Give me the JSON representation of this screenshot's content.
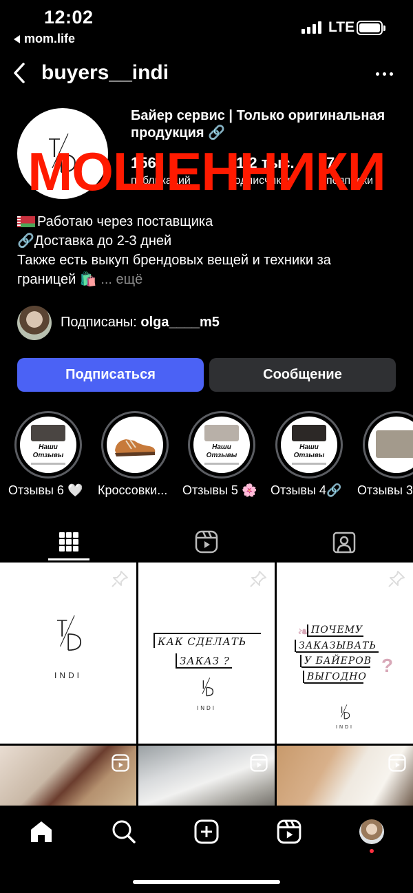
{
  "status": {
    "time": "12:02",
    "back_app": "mom.life",
    "network": "LTE"
  },
  "header": {
    "username": "buyers__indi"
  },
  "profile": {
    "avatar_logo": "I/D",
    "full_name": "Байер сервис | Только оригинальная продукция 🔗",
    "stats": [
      {
        "num": "156",
        "label": "публикаций"
      },
      {
        "num": "11,2 тыс.",
        "label": "подписчиков"
      },
      {
        "num": "7",
        "label": "подписки"
      }
    ],
    "overlay": "МОШЕННИКИ",
    "bio": {
      "line1": "Работаю через поставщика",
      "line2": "🔗Доставка до 2-3 дней",
      "line3": "Также есть выкуп брендовых вещей и техники за",
      "line4": "границей 🛍️",
      "more": "... ещё"
    },
    "followed_by": {
      "prefix": "Подписаны: ",
      "user": "olga____m5"
    }
  },
  "actions": {
    "follow": "Подписаться",
    "message": "Сообщение"
  },
  "highlights": [
    {
      "label": "Отзывы 6 🤍",
      "title": "Наши\nОтзывы"
    },
    {
      "label": "Кроссовки...",
      "title": ""
    },
    {
      "label": "Отзывы 5 🌸",
      "title": "Наши\nОтзывы"
    },
    {
      "label": "Отзывы 4🔗",
      "title": "Наши\nОтзывы"
    },
    {
      "label": "Отзывы 3",
      "title": ""
    }
  ],
  "posts": {
    "p1": {
      "logo": "I/D",
      "brand": "INDI"
    },
    "p2": {
      "line1": "КАК СДЕЛАТЬ",
      "line2": "ЗАКАЗ ?",
      "logo": "I/D",
      "brand": "INDI"
    },
    "p3": {
      "line1": "ПОЧЕМУ",
      "line2": "ЗАКАЗЫВАТЬ",
      "line3": "У БАЙЕРОВ",
      "line4": "ВЫГОДНО",
      "logo": "I/D",
      "brand": "INDI"
    }
  },
  "colors": {
    "accent": "#4b62f5",
    "overlay": "#ff1a00",
    "secondary_button": "#2f3033"
  }
}
